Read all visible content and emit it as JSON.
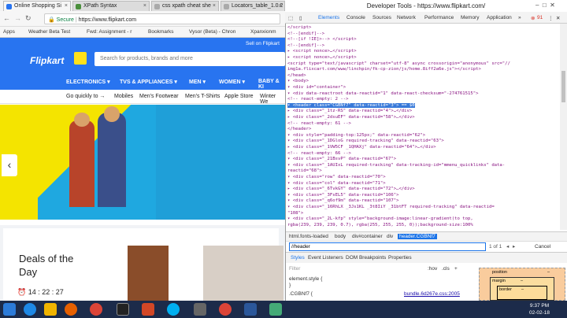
{
  "browser": {
    "tabs": [
      "Online Shopping Si",
      "XPath Syntax",
      "css xpath cheat she",
      "Locators_table_1.0.2"
    ],
    "secure_label": "Secure",
    "url": "https://www.flipkart.com",
    "bookmarks": [
      "Apps",
      "Weather Beta Test",
      "Fwd: Assignment - r",
      "Bookmarks",
      "Vysor (Beta) - Chron",
      "Xpanxionm"
    ]
  },
  "flipkart": {
    "logo": "Flipkart",
    "search_placeholder": "Search for products, brands and more",
    "sell": "Sell on Flipkart",
    "nav": [
      "ELECTRONICS ▾",
      "TVS & APPLIANCES ▾",
      "MEN ▾",
      "WOMEN ▾",
      "BABY & KI"
    ],
    "quick": [
      "Go quickly to →",
      "Mobiles",
      "Men's Footwear",
      "Men's T-Shirts",
      "Apple Store",
      "Winter We"
    ],
    "deals_title": "Deals of the Day",
    "timer": "14 : 22 : 27"
  },
  "devtools": {
    "title": "Developer Tools - https://www.flipkart.com/",
    "tabs": [
      "Elements",
      "Console",
      "Sources",
      "Network",
      "Performance",
      "Memory",
      "Application"
    ],
    "error_count": "91",
    "lines": [
      "  </script>",
      "  <!--[endif]-->",
      "<!--[if !IE]>--> </script>",
      "<!--[endif]-->",
      "▸ <script nonce>…</script>",
      "▸ <script nonce>…</script>",
      "  <script type=\"text/javascript\" charset=\"utf-8\" async crossorigin=\"anonymous\" src=\"//",
      "  img1a.flixcart.com/www/linchpin/fk-cp-zion/js/home.8iff2a6e.js\"></script>",
      "  </head>",
      "▾ <body>",
      "  ▾ <div id=\"container\">",
      "    ▾ <div data-reactroot data-reactid=\"1\" data-react-checksum=\"-274761515\">",
      "        <!-- react-empty: 2 -->",
      "      ▾ <header class=\"CGBNf7\" data-reactid=\"3\"> == $0",
      "        ▸ <div class=\"_1tz-RS\" data-reactid=\"4\">…</div>",
      "        ▸ <div class=\"_2dsuEF\" data-reactid=\"58\">…</div>",
      "          <!-- react-empty: 61 -->",
      "        </header>",
      "      ▾ <div style=\"padding-top:125px;\" data-reactid=\"62\">",
      "        ▾ <div class=\"_1DGloG required-tracking\" data-reactid=\"63\">",
      "          ▸ <div class=\"_1VW5CF _1QHAXj\" data-reactid=\"64\">…</div>",
      "            <!-- react-empty: 66 -->",
      "          ▾ <div class=\"_21BsvP\" data-reactid=\"67\">",
      "            ▾ <div class=\"_1AUIxL required-tracking\" data-tracking-id=\"mmenu_quicklinks\" data-",
      "              reactid=\"68\">",
      "              ▾ <div class=\"row\" data-reactid=\"70\">",
      "                ▾ <div class=\"col\" data-reactid=\"71\">",
      "                  ▸ <div class=\"_6TvkGY\" data-reactid=\"72\">…</div>",
      "                  ▾ <div class=\"_3FsEL5\" data-reactid=\"106\">",
      "                    ▾ <div class=\"_q6of9m\" data-reactid=\"107\">",
      "                      ▾ <div class=\"_16RhLX _3Js1KL _3t8IiY _31btFT required-tracking\" data-reactid=",
      "                        \"108\">",
      "                        ▾ <div class=\"_2L-kfp\" style=\"background-image:linear-gradient(to top,",
      "                          rgba(239, 239, 239, 0.7), rgba(255, 255, 255, 0));background-size:100%"
    ],
    "breadcrumbs": [
      "html.fonts-loaded",
      "body",
      "div#container",
      "div",
      "header.CGBNf7"
    ],
    "find_value": "//header",
    "find_count": "1 of 1",
    "cancel": "Cancel",
    "style_tabs": [
      "Styles",
      "Event Listeners",
      "DOM Breakpoints",
      "Properties"
    ],
    "filter": "Filter",
    "hov": ":hov",
    "cls": ".cls",
    "rule1": "element.style {",
    "rule1_end": "}",
    "rule2": ".CGBNf7 {",
    "rule2_src": "bundle.6d267e.css:2005",
    "box_position": "position",
    "box_margin": "margin",
    "box_border": "border",
    "box_dash": "–"
  },
  "taskbar": {
    "time": "9:37 PM",
    "date": "02-02-18"
  }
}
